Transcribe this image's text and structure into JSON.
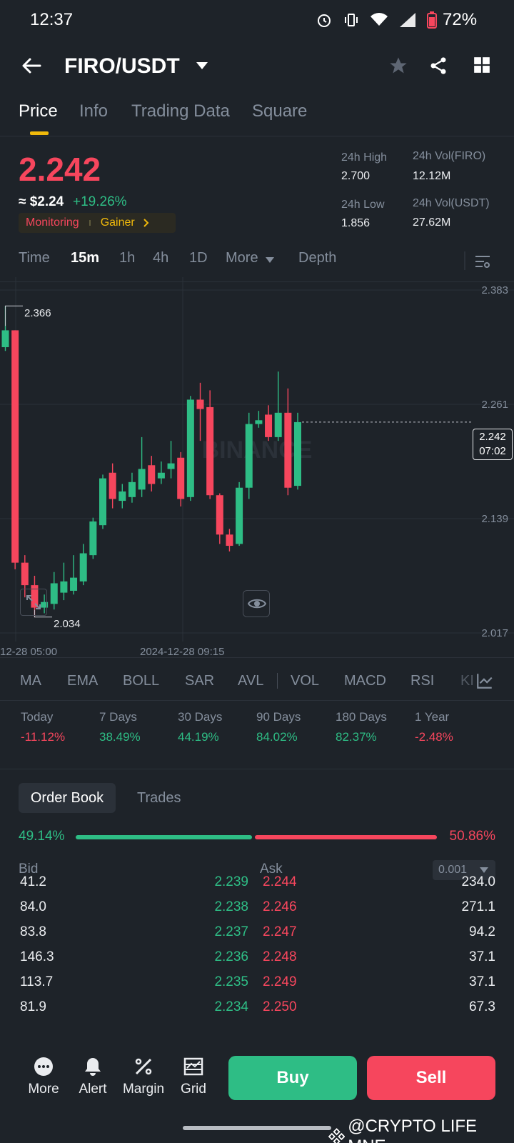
{
  "status_bar": {
    "time": "12:37",
    "battery": "72%"
  },
  "header": {
    "pair": "FIRO/USDT"
  },
  "tabs": [
    {
      "label": "Price",
      "active": true
    },
    {
      "label": "Info",
      "active": false
    },
    {
      "label": "Trading Data",
      "active": false
    },
    {
      "label": "Square",
      "active": false
    }
  ],
  "price": {
    "last": "2.242",
    "usd": "≈ $2.24",
    "change": "+19.26%",
    "tag_monitoring": "Monitoring",
    "tag_gainer": "Gainer"
  },
  "stats": {
    "high_label": "24h High",
    "high_value": "2.700",
    "low_label": "24h Low",
    "low_value": "1.856",
    "vol_base_label": "24h Vol(FIRO)",
    "vol_base_value": "12.12M",
    "vol_quote_label": "24h Vol(USDT)",
    "vol_quote_value": "27.62M"
  },
  "intervals": [
    "Time",
    "15m",
    "1h",
    "4h",
    "1D",
    "More",
    "Depth"
  ],
  "active_interval": "15m",
  "chart_data": {
    "type": "candlestick",
    "y_ticks": [
      "2.383",
      "2.261",
      "2.139",
      "2.017"
    ],
    "ylim": [
      2.017,
      2.383
    ],
    "x_ticks": [
      "12-28 05:00",
      "2024-12-28 09:15"
    ],
    "current_price": "2.242",
    "countdown": "07:02",
    "high_marker": "2.366",
    "low_marker": "2.034",
    "watermark": "BINANCE",
    "candles": [
      {
        "o": 2.322,
        "c": 2.34,
        "h": 2.366,
        "l": 2.318
      },
      {
        "o": 2.34,
        "c": 2.092,
        "h": 2.34,
        "l": 2.085
      },
      {
        "o": 2.092,
        "c": 2.068,
        "h": 2.1,
        "l": 2.055
      },
      {
        "o": 2.068,
        "c": 2.044,
        "h": 2.078,
        "l": 2.034
      },
      {
        "o": 2.044,
        "c": 2.05,
        "h": 2.058,
        "l": 2.038
      },
      {
        "o": 2.048,
        "c": 2.07,
        "h": 2.082,
        "l": 2.042
      },
      {
        "o": 2.06,
        "c": 2.072,
        "h": 2.092,
        "l": 2.052
      },
      {
        "o": 2.062,
        "c": 2.076,
        "h": 2.1,
        "l": 2.058
      },
      {
        "o": 2.072,
        "c": 2.102,
        "h": 2.112,
        "l": 2.068
      },
      {
        "o": 2.1,
        "c": 2.136,
        "h": 2.14,
        "l": 2.096
      },
      {
        "o": 2.132,
        "c": 2.182,
        "h": 2.186,
        "l": 2.128
      },
      {
        "o": 2.188,
        "c": 2.16,
        "h": 2.198,
        "l": 2.15
      },
      {
        "o": 2.158,
        "c": 2.168,
        "h": 2.176,
        "l": 2.15
      },
      {
        "o": 2.162,
        "c": 2.178,
        "h": 2.188,
        "l": 2.156
      },
      {
        "o": 2.17,
        "c": 2.192,
        "h": 2.226,
        "l": 2.162
      },
      {
        "o": 2.196,
        "c": 2.176,
        "h": 2.206,
        "l": 2.168
      },
      {
        "o": 2.182,
        "c": 2.188,
        "h": 2.2,
        "l": 2.176
      },
      {
        "o": 2.192,
        "c": 2.198,
        "h": 2.222,
        "l": 2.182
      },
      {
        "o": 2.204,
        "c": 2.16,
        "h": 2.21,
        "l": 2.152
      },
      {
        "o": 2.162,
        "c": 2.266,
        "h": 2.27,
        "l": 2.158
      },
      {
        "o": 2.266,
        "c": 2.256,
        "h": 2.284,
        "l": 2.222
      },
      {
        "o": 2.258,
        "c": 2.164,
        "h": 2.276,
        "l": 2.16
      },
      {
        "o": 2.164,
        "c": 2.122,
        "h": 2.166,
        "l": 2.112
      },
      {
        "o": 2.122,
        "c": 2.11,
        "h": 2.128,
        "l": 2.104
      },
      {
        "o": 2.112,
        "c": 2.172,
        "h": 2.178,
        "l": 2.11
      },
      {
        "o": 2.172,
        "c": 2.24,
        "h": 2.252,
        "l": 2.16
      },
      {
        "o": 2.24,
        "c": 2.244,
        "h": 2.254,
        "l": 2.236
      },
      {
        "o": 2.25,
        "c": 2.226,
        "h": 2.26,
        "l": 2.222
      },
      {
        "o": 2.226,
        "c": 2.252,
        "h": 2.296,
        "l": 2.222
      },
      {
        "o": 2.252,
        "c": 2.172,
        "h": 2.278,
        "l": 2.164
      },
      {
        "o": 2.174,
        "c": 2.242,
        "h": 2.252,
        "l": 2.17
      }
    ]
  },
  "indicators": [
    "MA",
    "EMA",
    "BOLL",
    "SAR",
    "AVL",
    "VOL",
    "MACD",
    "RSI",
    "KI"
  ],
  "performance": [
    {
      "label": "Today",
      "value": "-11.12%",
      "dir": "down"
    },
    {
      "label": "7 Days",
      "value": "38.49%",
      "dir": "up"
    },
    {
      "label": "30 Days",
      "value": "44.19%",
      "dir": "up"
    },
    {
      "label": "90 Days",
      "value": "84.02%",
      "dir": "up"
    },
    {
      "label": "180 Days",
      "value": "82.37%",
      "dir": "up"
    },
    {
      "label": "1 Year",
      "value": "-2.48%",
      "dir": "down"
    }
  ],
  "order_book": {
    "tab_active": "Order Book",
    "tab_other": "Trades",
    "bid_pct": "49.14%",
    "ask_pct": "50.86%",
    "bid_ratio": 0.4914,
    "bid_header": "Bid",
    "ask_header": "Ask",
    "precision": "0.001",
    "rows": [
      {
        "bid_qty": "41.2",
        "bid_price": "2.239",
        "ask_price": "2.244",
        "ask_qty": "234.0"
      },
      {
        "bid_qty": "84.0",
        "bid_price": "2.238",
        "ask_price": "2.246",
        "ask_qty": "271.1"
      },
      {
        "bid_qty": "83.8",
        "bid_price": "2.237",
        "ask_price": "2.247",
        "ask_qty": "94.2"
      },
      {
        "bid_qty": "146.3",
        "bid_price": "2.236",
        "ask_price": "2.248",
        "ask_qty": "37.1"
      },
      {
        "bid_qty": "113.7",
        "bid_price": "2.235",
        "ask_price": "2.249",
        "ask_qty": "37.1"
      },
      {
        "bid_qty": "81.9",
        "bid_price": "2.234",
        "ask_price": "2.250",
        "ask_qty": "67.3"
      }
    ]
  },
  "bottom_bar": {
    "more": "More",
    "alert": "Alert",
    "margin": "Margin",
    "grid": "Grid",
    "buy": "Buy",
    "sell": "Sell"
  },
  "watermark": "@CRYPTO LIFE MNE",
  "colors": {
    "up": "#2ebd85",
    "down": "#f6465d",
    "accent": "#f0b90b",
    "bg": "#1e2329"
  }
}
